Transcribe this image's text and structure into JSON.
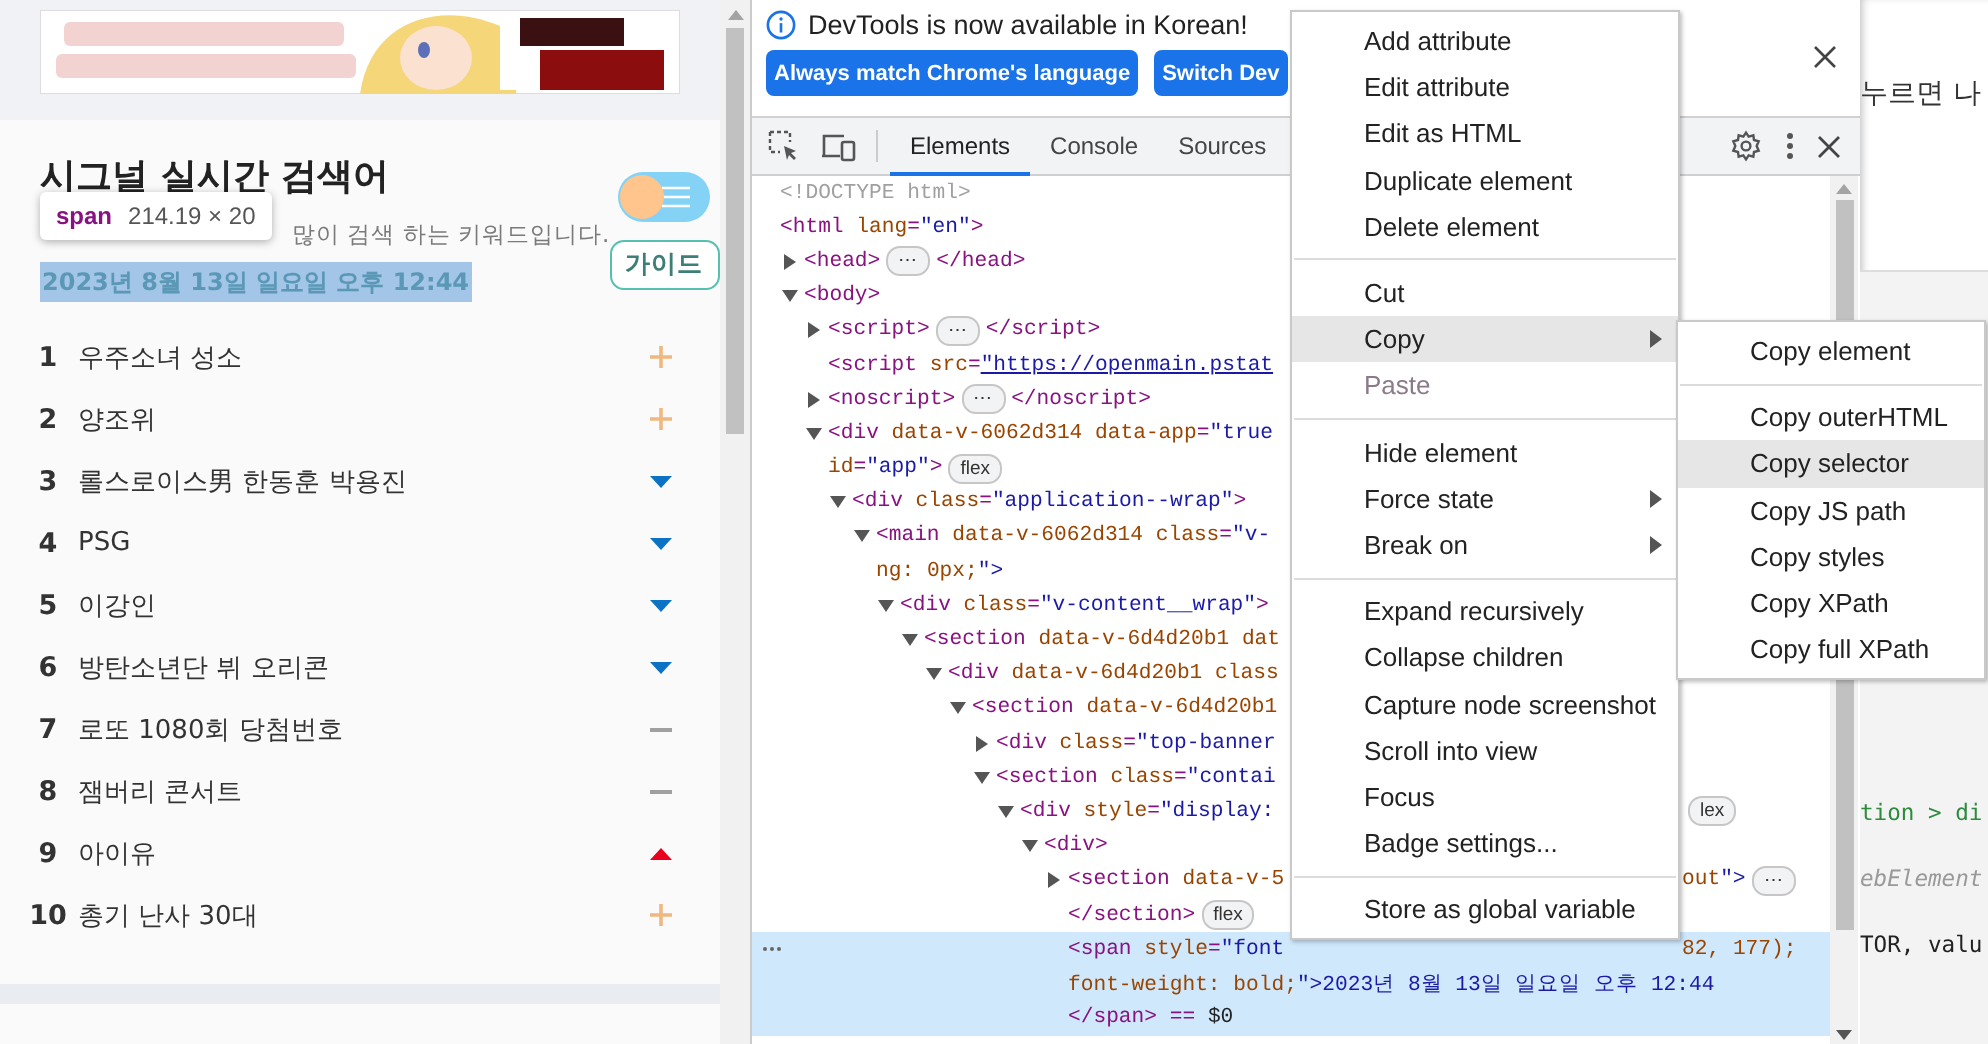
{
  "page": {
    "title": "시그널 실시간 검색어",
    "subtitle": "많이 검색 하는 키워드입니다.",
    "date": "2023년 8월 13일 일요일 오후 12:44",
    "inspect_highlight": true,
    "toggle_on": false,
    "guide_button": "가이드",
    "keywords": [
      {
        "rank": "1",
        "text": "우주소녀 성소",
        "kind": "new"
      },
      {
        "rank": "2",
        "text": "양조위",
        "kind": "new"
      },
      {
        "rank": "3",
        "text": "롤스로이스男 한동훈 박용진",
        "kind": "down"
      },
      {
        "rank": "4",
        "text": "PSG",
        "kind": "down"
      },
      {
        "rank": "5",
        "text": "이강인",
        "kind": "down"
      },
      {
        "rank": "6",
        "text": "방탄소년단 뷔 오리콘",
        "kind": "down"
      },
      {
        "rank": "7",
        "text": "로또 1080회 당첨번호",
        "kind": "same"
      },
      {
        "rank": "8",
        "text": "잼버리 콘서트",
        "kind": "same"
      },
      {
        "rank": "9",
        "text": "아이유",
        "kind": "up"
      },
      {
        "rank": "10",
        "text": "총기 난사 30대",
        "kind": "new"
      }
    ]
  },
  "inspect_tooltip": {
    "tag": "span",
    "size": "214.19 × 20"
  },
  "devtools": {
    "notice": "DevTools is now available in Korean!",
    "buttons": [
      "Always match Chrome's language",
      "Switch Dev"
    ],
    "tabs": [
      {
        "label": "Elements",
        "selected": true
      },
      {
        "label": "Console",
        "selected": false
      },
      {
        "label": "Sources",
        "selected": false
      }
    ],
    "dom_tree": [
      {
        "kind": "doctype",
        "text": "<!DOCTYPE html>"
      },
      {
        "text": "<html lang=\"en\">",
        "children": [
          {
            "text": "<head>",
            "badge": "⋯",
            "after": "</head>",
            "expanded": false
          },
          {
            "text": "<body>",
            "expanded": true,
            "children": [
              {
                "text": "<script>",
                "badge": "⋯",
                "after": "</script>",
                "expanded": false
              },
              {
                "text": "<script src=\"https://openmain.pstat",
                "link": true
              },
              {
                "text": "<noscript>",
                "badge": "⋯",
                "after": "</noscript>",
                "expanded": false
              },
              {
                "text": "<div data-v-6062d314 data-app=\"true",
                "more": [
                  "id=\"app\">"
                ],
                "more_badge": "flex",
                "expanded": true,
                "children": [
                  {
                    "text": "<div class=\"application--wrap\">",
                    "expanded": true,
                    "children": [
                      {
                        "text": "<main data-v-6062d314 class=\"v-",
                        "more": [
                          "ng: 0px;\">"
                        ],
                        "expanded": true,
                        "children": [
                          {
                            "text": "<div class=\"v-content__wrap\">",
                            "expanded": true,
                            "children": [
                              {
                                "text": "<section data-v-6d4d20b1 dat",
                                "expanded": true,
                                "children": [
                                  {
                                    "text": "<div data-v-6d4d20b1 class",
                                    "expanded": true,
                                    "children": [
                                      {
                                        "text": "<section data-v-6d4d20b1",
                                        "expanded": true,
                                        "children": [
                                          {
                                            "text": "<div class=\"top-banner",
                                            "expanded": false
                                          },
                                          {
                                            "text": "<section class=\"contai",
                                            "expanded": true,
                                            "children": [
                                              {
                                                "text": "<div style=\"display:",
                                                "tail_badge": "lex",
                                                "expanded": true,
                                                "children": [
                                                  {
                                                    "text": "<div>",
                                                    "expanded": true,
                                                    "children": [
                                                      {
                                                        "text": "<section data-v-5",
                                                        "tail": "out\">",
                                                        "tail_badge": "⋯",
                                                        "expanded": false
                                                      },
                                                      {
                                                        "text": "</section>",
                                                        "badge": "flex"
                                                      },
                                                      {
                                                        "text": "<span style=\"font",
                                                        "tail": "82, 177);",
                                                        "more": [
                                                          "font-weight: bold;\">2023년 8월 13일 일요일 오후 12:44",
                                                          "</span> == $0"
                                                        ],
                                                        "selected": true
                                                      }
                                                    ]
                                                  }
                                                ]
                                              }
                                            ]
                                          }
                                        ]
                                      }
                                    ]
                                  }
                                ]
                              }
                            ]
                          }
                        ]
                      }
                    ]
                  }
                ]
              }
            ]
          }
        ]
      }
    ]
  },
  "context_menu": {
    "items": [
      {
        "kind": "item",
        "label": "Add attribute",
        "highlighted": false,
        "disabled": false,
        "has_submenu": false
      },
      {
        "kind": "item",
        "label": "Edit attribute",
        "highlighted": false,
        "disabled": false,
        "has_submenu": false
      },
      {
        "kind": "item",
        "label": "Edit as HTML",
        "highlighted": false,
        "disabled": false,
        "has_submenu": false
      },
      {
        "kind": "item",
        "label": "Duplicate element",
        "highlighted": false,
        "disabled": false,
        "has_submenu": false
      },
      {
        "kind": "item",
        "label": "Delete element",
        "highlighted": false,
        "disabled": false,
        "has_submenu": false
      },
      {
        "kind": "separator"
      },
      {
        "kind": "item",
        "label": "Cut",
        "highlighted": false,
        "disabled": false,
        "has_submenu": false
      },
      {
        "kind": "item",
        "label": "Copy",
        "highlighted": true,
        "disabled": false,
        "has_submenu": true
      },
      {
        "kind": "item",
        "label": "Paste",
        "highlighted": false,
        "disabled": true,
        "has_submenu": false
      },
      {
        "kind": "separator"
      },
      {
        "kind": "item",
        "label": "Hide element",
        "highlighted": false,
        "disabled": false,
        "has_submenu": false
      },
      {
        "kind": "item",
        "label": "Force state",
        "highlighted": false,
        "disabled": false,
        "has_submenu": true
      },
      {
        "kind": "item",
        "label": "Break on",
        "highlighted": false,
        "disabled": false,
        "has_submenu": true
      },
      {
        "kind": "separator"
      },
      {
        "kind": "item",
        "label": "Expand recursively",
        "highlighted": false,
        "disabled": false,
        "has_submenu": false
      },
      {
        "kind": "item",
        "label": "Collapse children",
        "highlighted": false,
        "disabled": false,
        "has_submenu": false
      },
      {
        "kind": "item",
        "label": "Capture node screenshot",
        "highlighted": false,
        "disabled": false,
        "has_submenu": false
      },
      {
        "kind": "item",
        "label": "Scroll into view",
        "highlighted": false,
        "disabled": false,
        "has_submenu": false
      },
      {
        "kind": "item",
        "label": "Focus",
        "highlighted": false,
        "disabled": false,
        "has_submenu": false
      },
      {
        "kind": "item",
        "label": "Badge settings...",
        "highlighted": false,
        "disabled": false,
        "has_submenu": false
      },
      {
        "kind": "separator"
      },
      {
        "kind": "item",
        "label": "Store as global variable",
        "highlighted": false,
        "disabled": false,
        "has_submenu": false
      }
    ]
  },
  "copy_submenu": {
    "items": [
      {
        "kind": "item",
        "label": "Copy element",
        "highlighted": false,
        "disabled": false,
        "has_submenu": false
      },
      {
        "kind": "separator"
      },
      {
        "kind": "item",
        "label": "Copy outerHTML",
        "highlighted": false,
        "disabled": false,
        "has_submenu": false
      },
      {
        "kind": "item",
        "label": "Copy selector",
        "highlighted": true,
        "disabled": false,
        "has_submenu": false
      },
      {
        "kind": "item",
        "label": "Copy JS path",
        "highlighted": false,
        "disabled": false,
        "has_submenu": false
      },
      {
        "kind": "item",
        "label": "Copy styles",
        "highlighted": false,
        "disabled": false,
        "has_submenu": false
      },
      {
        "kind": "item",
        "label": "Copy XPath",
        "highlighted": false,
        "disabled": false,
        "has_submenu": false
      },
      {
        "kind": "item",
        "label": "Copy full XPath",
        "highlighted": false,
        "disabled": false,
        "has_submenu": false
      }
    ]
  },
  "page_right": {
    "text": "누르면 나",
    "code_lines": [
      {
        "kind": "selector",
        "text": "tion > di"
      },
      {
        "kind": "comment",
        "text": "ebElement"
      },
      {
        "kind": "plain",
        "text": "TOR, valu"
      }
    ]
  }
}
